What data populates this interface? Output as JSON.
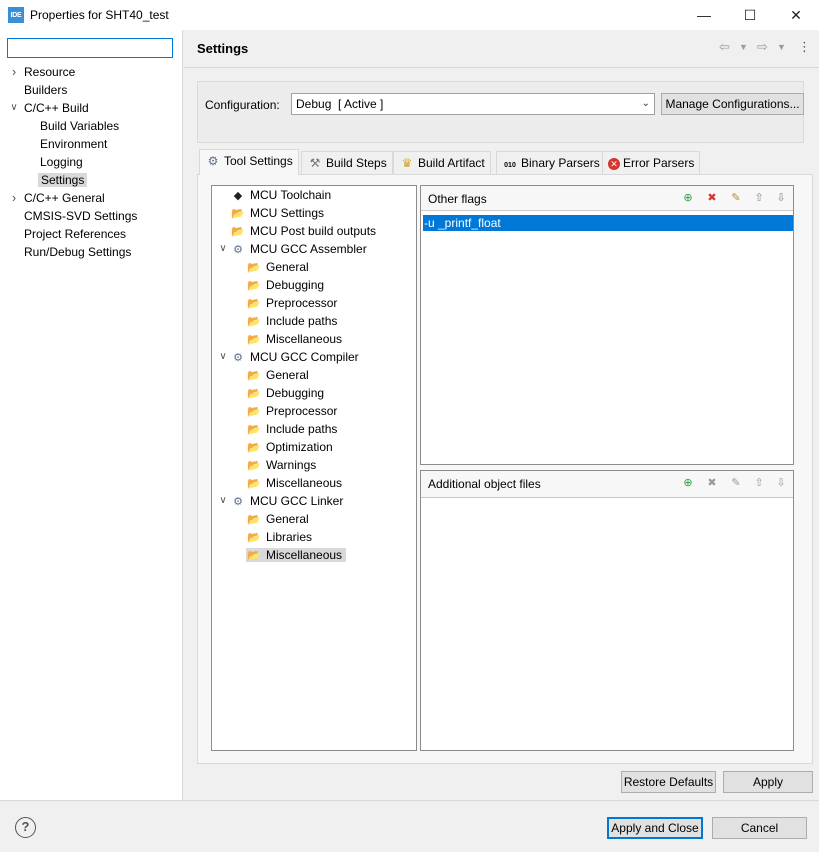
{
  "window": {
    "icon_text": "IDE",
    "title": "Properties for SHT40_test",
    "minimize": "—",
    "maximize": "☐",
    "close": "✕"
  },
  "filter": {
    "value": "",
    "placeholder": ""
  },
  "nav": {
    "items": [
      {
        "label": "Resource",
        "expandable": true,
        "expanded": false
      },
      {
        "label": "Builders",
        "expandable": false
      },
      {
        "label": "C/C++ Build",
        "expandable": true,
        "expanded": true
      },
      {
        "label": "Build Variables",
        "child": true
      },
      {
        "label": "Environment",
        "child": true
      },
      {
        "label": "Logging",
        "child": true
      },
      {
        "label": "Settings",
        "child": true,
        "selected": true
      },
      {
        "label": "C/C++ General",
        "expandable": true,
        "expanded": false
      },
      {
        "label": "CMSIS-SVD Settings",
        "expandable": false
      },
      {
        "label": "Project References",
        "expandable": false
      },
      {
        "label": "Run/Debug Settings",
        "expandable": false
      }
    ]
  },
  "header": {
    "title": "Settings",
    "back_icon": "arrow-left-icon",
    "forward_icon": "arrow-right-icon",
    "menu_icon": "vertical-dots-icon"
  },
  "configuration": {
    "label": "Configuration:",
    "selected": "Debug  [ Active ]",
    "manage_button": "Manage Configurations..."
  },
  "tabs": [
    {
      "label": "Tool Settings",
      "icon": "gear-icon",
      "active": true
    },
    {
      "label": "Build Steps",
      "icon": "hammer-icon"
    },
    {
      "label": "Build Artifact",
      "icon": "trophy-icon"
    },
    {
      "label": "Binary Parsers",
      "icon": "binary-icon"
    },
    {
      "label": "Error Parsers",
      "icon": "error-icon"
    }
  ],
  "tool_tree": [
    {
      "label": "MCU Toolchain",
      "icon": "chip-icon",
      "level": 0
    },
    {
      "label": "MCU Settings",
      "icon": "folder-gear-icon",
      "level": 0
    },
    {
      "label": "MCU Post build outputs",
      "icon": "folder-gear-icon",
      "level": 0
    },
    {
      "label": "MCU GCC Assembler",
      "icon": "gear-icon",
      "level": 0,
      "expanded": true
    },
    {
      "label": "General",
      "icon": "folder-gear-icon",
      "level": 1
    },
    {
      "label": "Debugging",
      "icon": "folder-gear-icon",
      "level": 1
    },
    {
      "label": "Preprocessor",
      "icon": "folder-gear-icon",
      "level": 1
    },
    {
      "label": "Include paths",
      "icon": "folder-gear-icon",
      "level": 1
    },
    {
      "label": "Miscellaneous",
      "icon": "folder-gear-icon",
      "level": 1
    },
    {
      "label": "MCU GCC Compiler",
      "icon": "gear-icon",
      "level": 0,
      "expanded": true
    },
    {
      "label": "General",
      "icon": "folder-gear-icon",
      "level": 1
    },
    {
      "label": "Debugging",
      "icon": "folder-gear-icon",
      "level": 1
    },
    {
      "label": "Preprocessor",
      "icon": "folder-gear-icon",
      "level": 1
    },
    {
      "label": "Include paths",
      "icon": "folder-gear-icon",
      "level": 1
    },
    {
      "label": "Optimization",
      "icon": "folder-gear-icon",
      "level": 1
    },
    {
      "label": "Warnings",
      "icon": "folder-gear-icon",
      "level": 1
    },
    {
      "label": "Miscellaneous",
      "icon": "folder-gear-icon",
      "level": 1
    },
    {
      "label": "MCU GCC Linker",
      "icon": "gear-icon",
      "level": 0,
      "expanded": true
    },
    {
      "label": "General",
      "icon": "folder-gear-icon",
      "level": 1
    },
    {
      "label": "Libraries",
      "icon": "folder-gear-icon",
      "level": 1
    },
    {
      "label": "Miscellaneous",
      "icon": "folder-gear-icon",
      "level": 1,
      "selected": true
    }
  ],
  "other_flags": {
    "title": "Other flags",
    "values": [
      "-u _printf_float"
    ],
    "tool_icons": [
      "add-icon",
      "delete-icon",
      "edit-icon",
      "move-up-icon",
      "move-down-icon"
    ]
  },
  "additional_objects": {
    "title": "Additional object files",
    "values": [],
    "tool_icons": [
      "add-icon",
      "delete-icon",
      "edit-icon",
      "move-up-icon",
      "move-down-icon"
    ]
  },
  "buttons": {
    "restore_defaults": "Restore Defaults",
    "apply": "Apply",
    "apply_and_close": "Apply and Close",
    "cancel": "Cancel",
    "help": "?"
  }
}
